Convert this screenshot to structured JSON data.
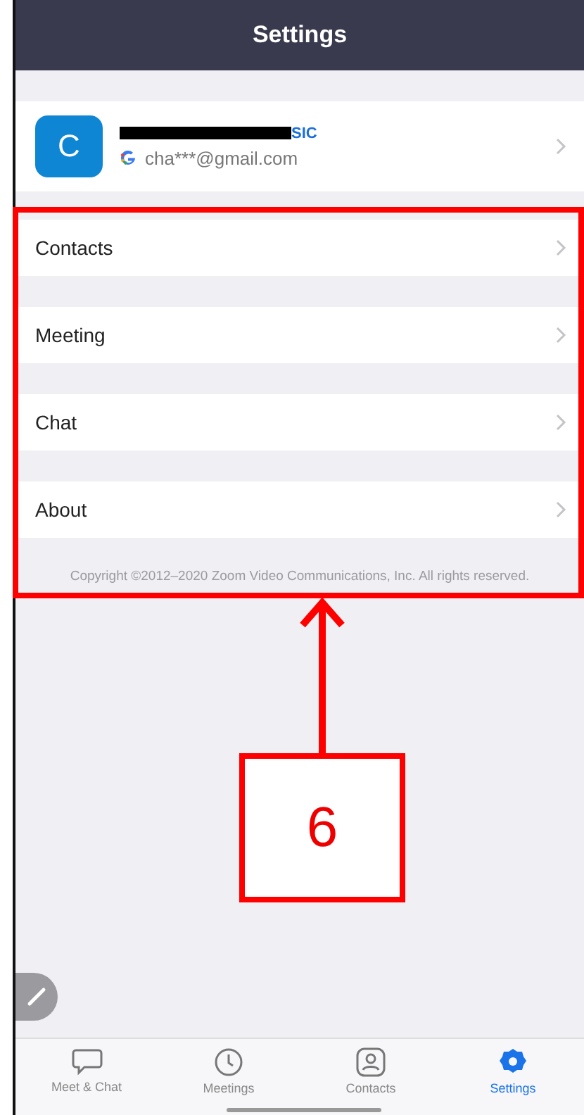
{
  "header": {
    "title": "Settings"
  },
  "profile": {
    "initial": "C",
    "badge": "SIC",
    "email": "cha***@gmail.com"
  },
  "menu": [
    {
      "label": "Contacts"
    },
    {
      "label": "Meeting"
    },
    {
      "label": "Chat"
    },
    {
      "label": "About"
    }
  ],
  "copyright": "Copyright ©2012–2020 Zoom Video Communications, Inc. All rights reserved.",
  "tabs": [
    {
      "label": "Meet & Chat",
      "kind": "chat",
      "selected": false
    },
    {
      "label": "Meetings",
      "kind": "clock",
      "selected": false
    },
    {
      "label": "Contacts",
      "kind": "contact",
      "selected": false
    },
    {
      "label": "Settings",
      "kind": "gear",
      "selected": true
    }
  ],
  "annotation": {
    "label": "6"
  }
}
